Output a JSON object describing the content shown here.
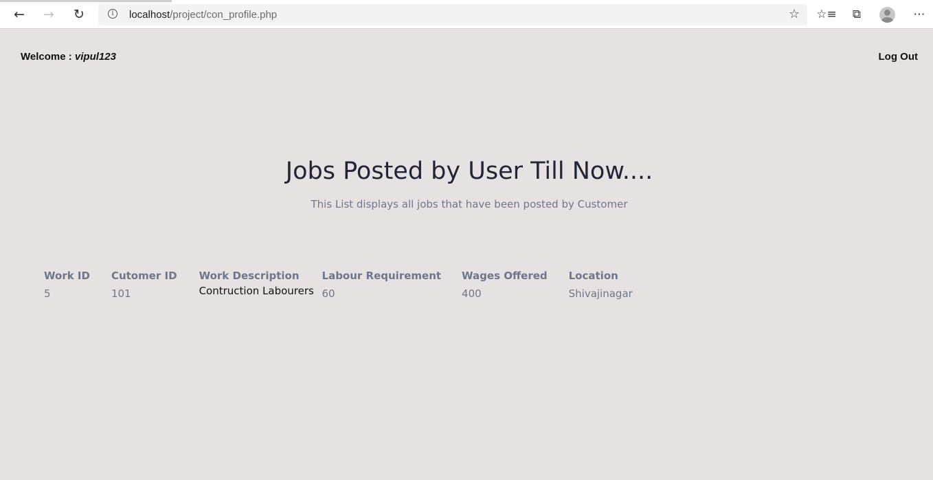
{
  "browser": {
    "url_host": "localhost",
    "url_path": "/project/con_profile.php",
    "icons": [
      "back-icon",
      "forward-icon",
      "refresh-icon",
      "site-info-icon",
      "favorite-star-icon",
      "favorites-list-icon",
      "collections-icon",
      "profile-avatar",
      "more-options-icon"
    ]
  },
  "header": {
    "welcome_label": "Welcome : ",
    "username": "vipul123",
    "logout_label": "Log Out"
  },
  "main": {
    "title": "Jobs Posted by User Till Now....",
    "subtitle": "This List displays all jobs that have been posted by Customer"
  },
  "table": {
    "headers": [
      "Work ID",
      "Cutomer ID",
      "Work Description",
      "Labour Requirement",
      "Wages Offered",
      "Location"
    ],
    "rows": [
      [
        "5",
        "101",
        "Contruction Labourers",
        "60",
        "400",
        "Shivajinagar"
      ]
    ]
  },
  "colors": {
    "page_background": "#e6e2e2",
    "muted_text": "#6f7689",
    "title_text": "#222533"
  }
}
